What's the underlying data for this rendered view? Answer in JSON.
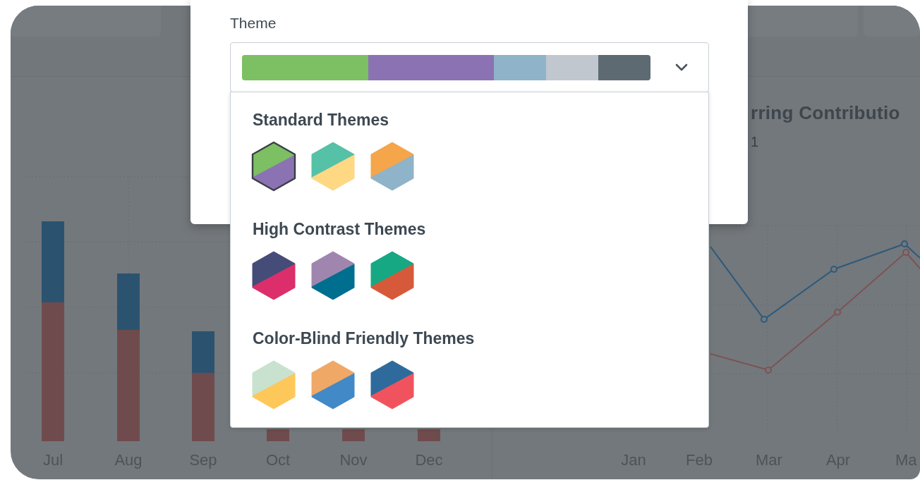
{
  "dialog": {
    "label": "Theme",
    "select": {
      "segments": [
        {
          "color": "#7dbf63",
          "kind": "wide"
        },
        {
          "color": "#8b72b3",
          "kind": "wide"
        },
        {
          "color": "#8fb3c8",
          "kind": "narrow"
        },
        {
          "color": "#c0c7ce",
          "kind": "narrow"
        },
        {
          "color": "#5d6a72",
          "kind": "narrow"
        }
      ]
    },
    "dropdown": {
      "groups": [
        {
          "heading": "Standard Themes",
          "themes": [
            {
              "halves": [
                {
                  "color": "#7dbf63"
                },
                {
                  "color": "#8b72b3"
                }
              ],
              "selected": true
            },
            {
              "halves": [
                {
                  "color": "#55c1a7"
                },
                {
                  "color": "#fed883"
                }
              ],
              "selected": false
            },
            {
              "halves": [
                {
                  "color": "#f5a54a"
                },
                {
                  "color": "#8fb3c8"
                }
              ],
              "selected": false
            }
          ]
        },
        {
          "heading": "High Contrast Themes",
          "themes": [
            {
              "halves": [
                {
                  "color": "#454c78"
                },
                {
                  "color": "#db2e6a"
                }
              ],
              "selected": false
            },
            {
              "halves": [
                {
                  "color": "#a086ae"
                },
                {
                  "color": "#006e8f"
                }
              ],
              "selected": false
            },
            {
              "halves": [
                {
                  "color": "#16a883"
                },
                {
                  "color": "#d65a3a"
                }
              ],
              "selected": false
            }
          ]
        },
        {
          "heading": "Color-Blind Friendly Themes",
          "themes": [
            {
              "halves": [
                {
                  "color": "#c9e2cf"
                },
                {
                  "color": "#fec759"
                }
              ],
              "selected": false
            },
            {
              "halves": [
                {
                  "color": "#efa866"
                },
                {
                  "color": "#4189c7"
                }
              ],
              "selected": false
            },
            {
              "halves": [
                {
                  "color": "#2e6b9c"
                },
                {
                  "color": "#f0535d"
                }
              ],
              "selected": false
            }
          ]
        }
      ]
    }
  },
  "background": {
    "bar_chart": {
      "x_labels": [
        "Jul",
        "Aug",
        "Sep",
        "Oct",
        "Nov",
        "Dec"
      ]
    },
    "line_chart": {
      "title": "rring Contributio",
      "subtitle": "1",
      "x_labels": [
        "Jan",
        "Feb",
        "Mar",
        "Apr",
        "Ma"
      ]
    }
  }
}
